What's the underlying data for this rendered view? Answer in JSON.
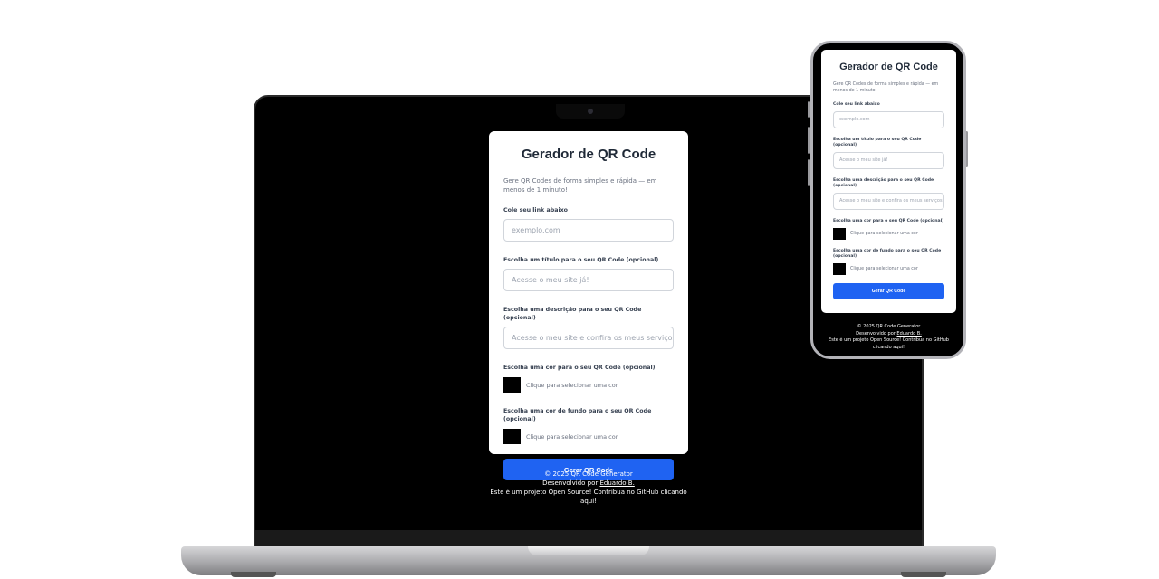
{
  "app": {
    "title": "Gerador de QR Code",
    "subtitle": "Gere QR Codes de forma simples e rápida — em menos de 1 minuto!",
    "link_label": "Cole seu link abaixo",
    "link_placeholder": "exemplo.com",
    "title_label": "Escolha um título para o seu QR Code (opcional)",
    "title_placeholder": "Acesse o meu site já!",
    "description_label": "Escolha uma descrição para o seu QR Code (opcional)",
    "description_placeholder": "Acesse o meu site e confira os meus serviços.",
    "color_label": "Escolha uma cor para o seu QR Code (opcional)",
    "color_hint": "Clique para selecionar uma cor",
    "bg_color_label": "Escolha uma cor de fundo para o seu QR Code (opcional)",
    "bg_color_hint": "Clique para selecionar uma cor",
    "generate_button": "Gerar QR Code"
  },
  "footer": {
    "copyright": "© 2025 QR Code Generator",
    "developed_by": "Desenvolvido por",
    "author": "Eduardo B.",
    "open_source": "Este é um projeto Open Source! Contribua no GitHub clicando aqui!"
  },
  "colors": {
    "accent": "#1f63f2",
    "qr_color": "#000000",
    "qr_bg_color": "#000000",
    "screen_bg": "#000000"
  }
}
